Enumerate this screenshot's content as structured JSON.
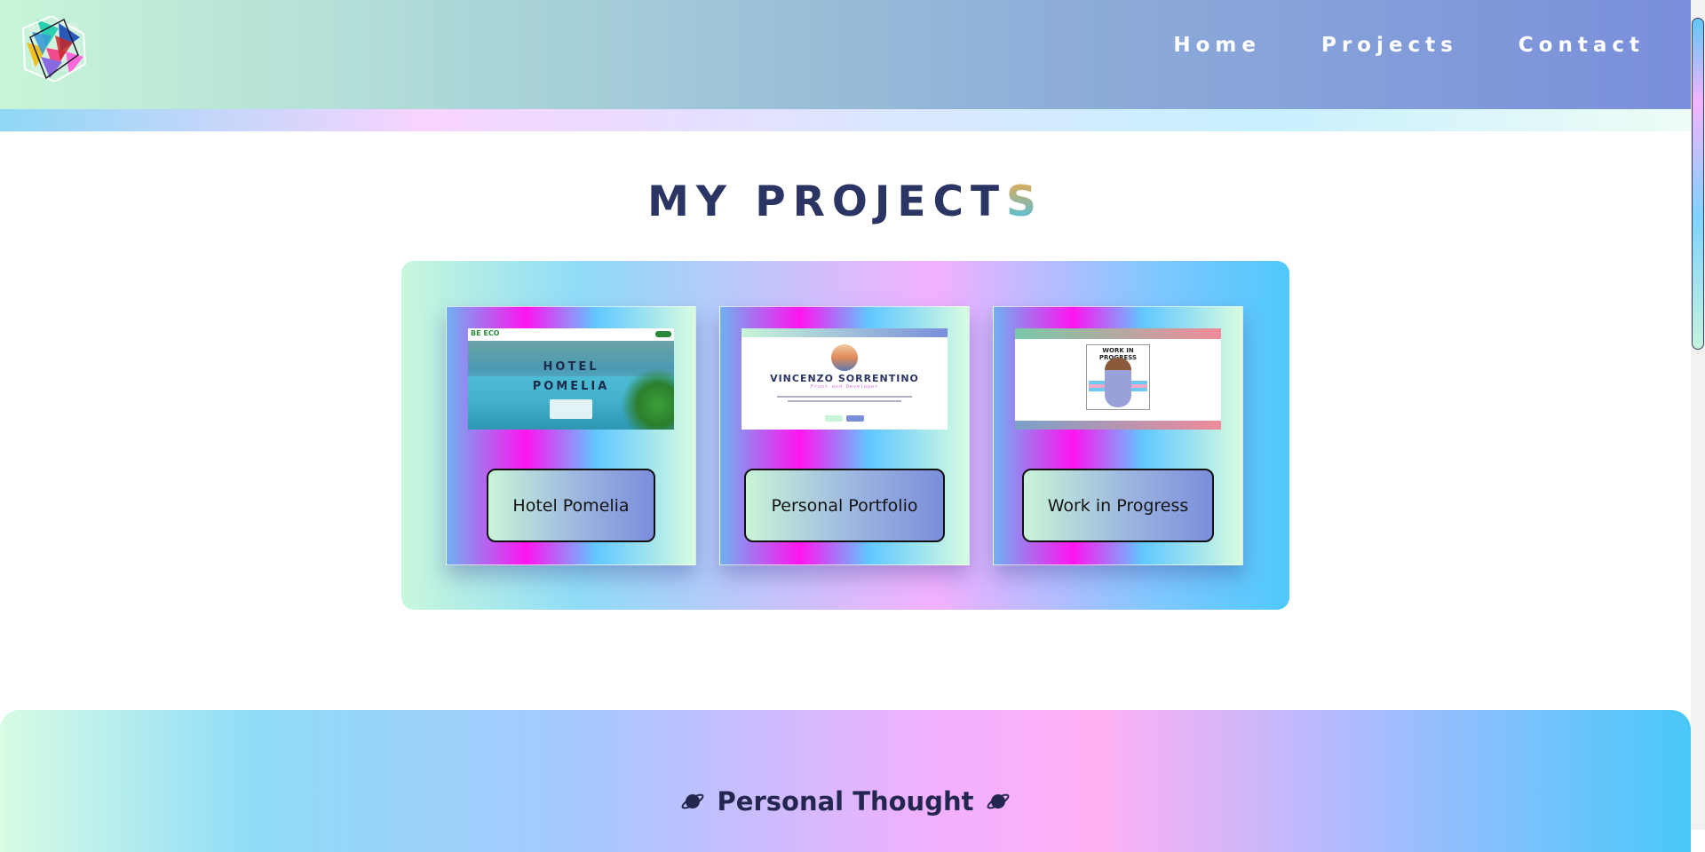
{
  "header": {
    "logo_icon": "geometric-logo-icon",
    "nav": [
      {
        "label": "Home"
      },
      {
        "label": "Projects"
      },
      {
        "label": "Contact"
      }
    ]
  },
  "projects": {
    "title_main": "MY PROJECT",
    "title_last": "S",
    "cards": [
      {
        "button_label": "Hotel Pomelia",
        "thumbnail": {
          "brand": "BE ECO",
          "title_line1": "HOTEL",
          "title_line2": "POMELIA"
        }
      },
      {
        "button_label": "Personal Portfolio",
        "thumbnail": {
          "name": "VINCENZO SORRENTINO",
          "subtitle": "Front end Developer"
        }
      },
      {
        "button_label": "Work in Progress",
        "thumbnail": {
          "caption": "WORK IN PROGRESS"
        }
      }
    ]
  },
  "thoughts": {
    "title": "Personal Thought",
    "icon": "planet-icon"
  },
  "colors": {
    "title_color": "#2b3563",
    "nav_text": "#ffffff",
    "button_border": "#111111"
  }
}
